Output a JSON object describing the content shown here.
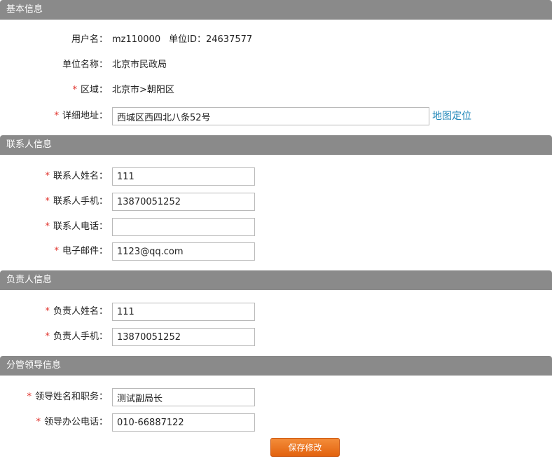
{
  "sections": {
    "basic": "基本信息",
    "contact": "联系人信息",
    "principal": "负责人信息",
    "leader": "分管领导信息"
  },
  "basic": {
    "username_label": "用户名：",
    "username": "mz110000",
    "unit_id_label": "单位ID：",
    "unit_id": "24637577",
    "unit_name_label": "单位名称：",
    "unit_name": "北京市民政局",
    "region_label": "区域：",
    "region": "北京市>朝阳区",
    "address_label": "详细地址：",
    "address": "西城区西四北八条52号",
    "map_link": "地图定位"
  },
  "contact": {
    "name_label": "联系人姓名：",
    "name": "111",
    "mobile_label": "联系人手机：",
    "mobile": "13870051252",
    "phone_label": "联系人电话：",
    "phone": "",
    "email_label": "电子邮件：",
    "email": "1123@qq.com"
  },
  "principal": {
    "name_label": "负责人姓名：",
    "name": "111",
    "mobile_label": "负责人手机：",
    "mobile": "13870051252"
  },
  "leader": {
    "name_title_label": "领导姓名和职务：",
    "name_title": "测试副局长",
    "office_phone_label": "领导办公电话：",
    "office_phone": "010-66887122"
  },
  "required_mark": "*",
  "save_button": "保存修改",
  "colors": {
    "header_bg": "#8a8a8a",
    "required": "#e0302a",
    "link": "#1f86b8",
    "button": "#e2620e"
  }
}
